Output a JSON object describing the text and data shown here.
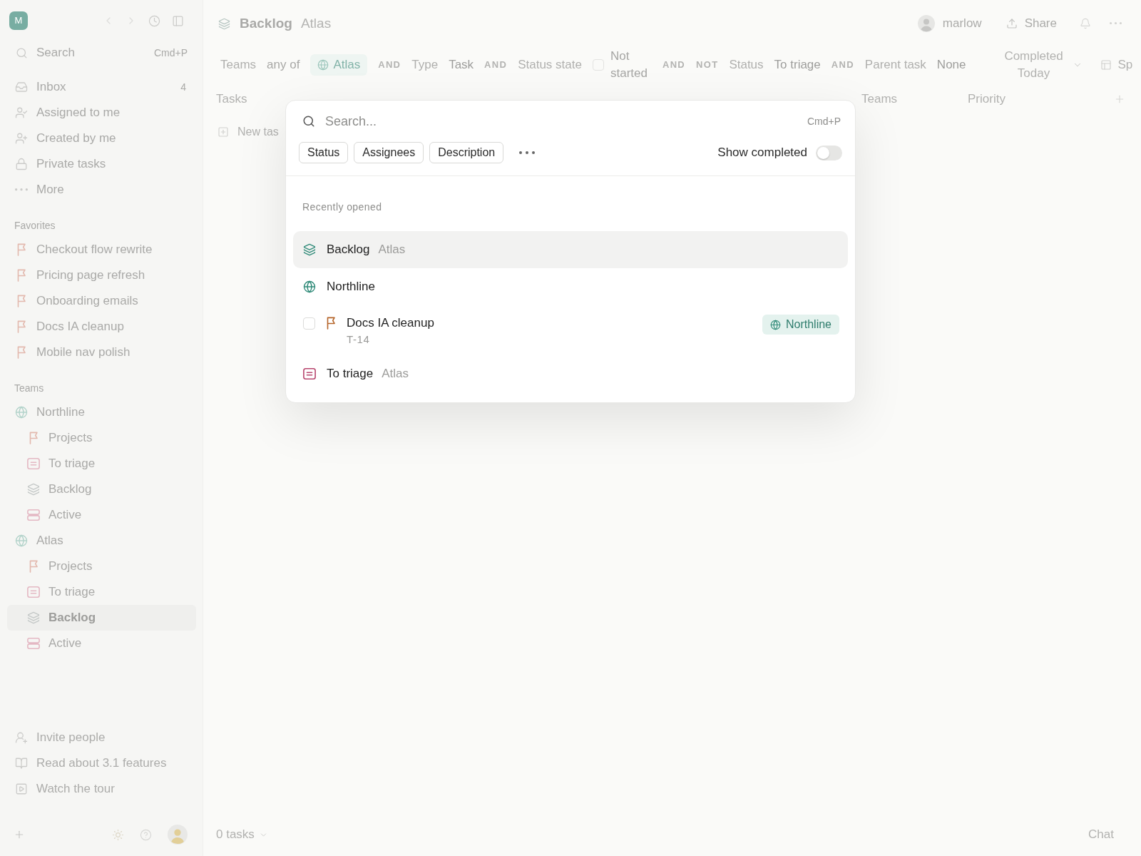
{
  "sidebar": {
    "logo": "M",
    "search": {
      "label": "Search",
      "shortcut": "Cmd+P"
    },
    "nav": [
      {
        "kind": "inbox",
        "label": "Inbox",
        "count": "4",
        "selected": false
      },
      {
        "kind": "assigned",
        "label": "Assigned to me",
        "selected": false
      },
      {
        "kind": "created",
        "label": "Created by me",
        "selected": false
      },
      {
        "kind": "private",
        "label": "Private tasks",
        "selected": false
      },
      {
        "kind": "more",
        "label": "More",
        "selected": false
      }
    ],
    "favorites": {
      "heading": "Favorites",
      "items": [
        {
          "label": "Checkout flow rewrite",
          "selected": false
        },
        {
          "label": "Pricing page refresh",
          "selected": false
        },
        {
          "label": "Onboarding emails",
          "selected": false
        },
        {
          "label": "Docs IA cleanup",
          "selected": false
        },
        {
          "label": "Mobile nav polish",
          "selected": false
        }
      ]
    },
    "teams": {
      "heading": "Teams",
      "items": [
        {
          "label": "Northline",
          "selected": false,
          "children": [
            {
              "kind": "projects",
              "label": "Projects",
              "selected": false
            },
            {
              "kind": "triage",
              "label": "To triage",
              "selected": false
            },
            {
              "kind": "backlog",
              "label": "Backlog",
              "selected": false
            },
            {
              "kind": "active",
              "label": "Active",
              "selected": false
            }
          ]
        },
        {
          "label": "Atlas",
          "selected": false,
          "children": [
            {
              "kind": "projects",
              "label": "Projects",
              "selected": false
            },
            {
              "kind": "triage",
              "label": "To triage",
              "selected": false
            },
            {
              "kind": "backlog",
              "label": "Backlog",
              "selected": true
            },
            {
              "kind": "active",
              "label": "Active",
              "selected": false
            }
          ]
        }
      ]
    },
    "links": [
      {
        "kind": "invite",
        "label": "Invite people"
      },
      {
        "kind": "read",
        "label": "Read about 3.1 features"
      },
      {
        "kind": "tour",
        "label": "Watch the tour"
      }
    ]
  },
  "header": {
    "title": "Backlog",
    "team": "Atlas",
    "user": "marlow",
    "share": "Share"
  },
  "filters": [
    {
      "kind": "field",
      "text": "Teams"
    },
    {
      "kind": "operator",
      "text": "any of"
    },
    {
      "kind": "team",
      "text": "Atlas"
    },
    {
      "kind": "conjunction",
      "text": "AND"
    },
    {
      "kind": "field",
      "text": "Type"
    },
    {
      "kind": "value",
      "text": "Task"
    },
    {
      "kind": "conjunction",
      "text": "AND"
    },
    {
      "kind": "field",
      "text": "Status state"
    },
    {
      "kind": "checkbox",
      "text": "Not started",
      "checked": false
    },
    {
      "kind": "conjunction",
      "text": "AND"
    },
    {
      "kind": "conjunction",
      "text": "NOT"
    },
    {
      "kind": "field",
      "text": "Status"
    },
    {
      "kind": "value",
      "text": "To triage"
    },
    {
      "kind": "conjunction",
      "text": "AND"
    },
    {
      "kind": "field",
      "text": "Parent task"
    },
    {
      "kind": "value",
      "text": "None"
    }
  ],
  "completed_filter": "Completed Today",
  "view_button": "Sp",
  "columns": [
    "Tasks",
    "Teams",
    "Priority"
  ],
  "new_task": "New tas",
  "footer": {
    "count": "0 tasks",
    "chat": "Chat"
  },
  "command_palette": {
    "search": {
      "placeholder": "Search...",
      "shortcut": "Cmd+P"
    },
    "scopes": [
      "Status",
      "Assignees",
      "Description"
    ],
    "show_completed": {
      "label": "Show completed",
      "on": false
    },
    "section": "Recently opened",
    "results": [
      {
        "kind": "backlog",
        "title": "Backlog",
        "context": "Atlas",
        "selected": true
      },
      {
        "kind": "team",
        "title": "Northline",
        "selected": false
      },
      {
        "kind": "task",
        "title": "Docs IA cleanup",
        "id": "T-14",
        "checked": false,
        "team": "Northline",
        "selected": false
      },
      {
        "kind": "triage",
        "title": "To triage",
        "context": "Atlas",
        "selected": false
      }
    ]
  }
}
